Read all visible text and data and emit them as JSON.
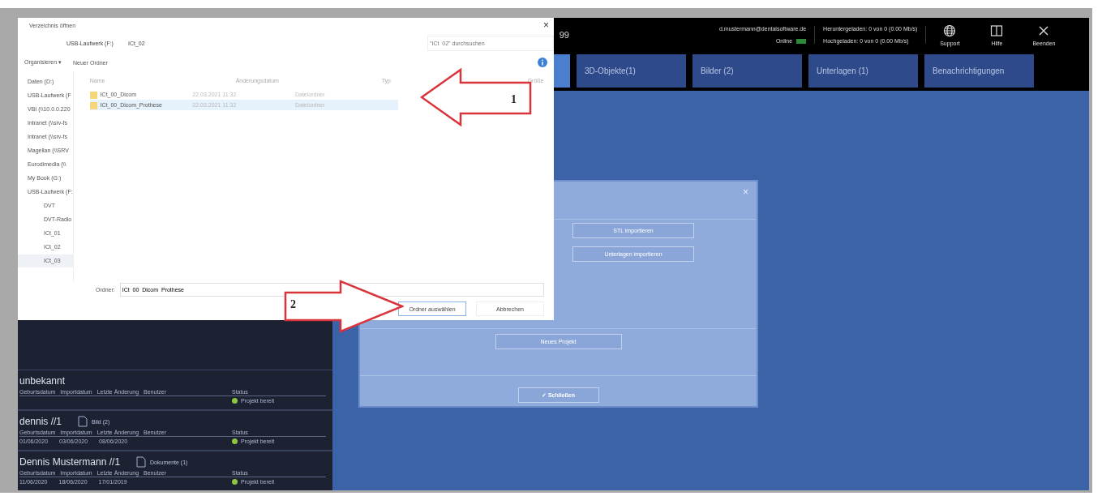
{
  "app": {
    "title_fragment": "99",
    "account": "d.mustermann@dentalsoftware.de",
    "online_label": "Online",
    "online": true,
    "transfers": [
      "Heruntergeladen: 0 von 0 (0.00 Mb/s)",
      "Hochgeladen: 0 von 0 (0.00 Mb/s)"
    ],
    "actions": [
      {
        "kind": "globe",
        "label": "Support"
      },
      {
        "kind": "panel",
        "label": "Hilfe"
      },
      {
        "kind": "close",
        "label": "Beenden"
      }
    ]
  },
  "tabs": [
    {
      "selected": true
    },
    {
      "label": "3D-Objekte(1)",
      "selected": false
    },
    {
      "label": "Bilder (2)",
      "selected": false
    },
    {
      "label": "Unterlagen (1)",
      "selected": false
    },
    {
      "label": "Benachrichtigungen",
      "selected": false
    }
  ],
  "patients": [
    {
      "name": "unbekannt",
      "headers": [
        "Geburtsdatum",
        "Importdatum",
        "Letzte Änderung",
        "Benutzer"
      ],
      "status_label": "Status",
      "status": "Projekt bereit",
      "color": "#8dc63f"
    },
    {
      "name": "dennis //1",
      "attachment": {
        "kind": "file",
        "label": "Bild (2)"
      },
      "headers": [
        "Geburtsdatum",
        "Importdatum",
        "Letzte Änderung",
        "Benutzer"
      ],
      "values": [
        "01/06/2020",
        "03/06/2020",
        "08/06/2020"
      ],
      "status_label": "Status",
      "status": "Projekt bereit",
      "color": "#8dc63f"
    },
    {
      "name": "Dennis Mustermann //1",
      "attachment": {
        "kind": "file",
        "label": "Dokumente (1)"
      },
      "headers": [
        "Geburtsdatum",
        "Importdatum",
        "Letzte Änderung",
        "Benutzer"
      ],
      "values": [
        "11/06/2020",
        "18/06/2020",
        "17/01/2019"
      ],
      "status_label": "Status",
      "status": "Projekt bereit",
      "color": "#8dc63f"
    }
  ],
  "modal": {
    "close": "×",
    "import_buttons": [
      "STL importieren",
      "Unterlagen importieren"
    ],
    "project_button": "Neues Projekt",
    "confirm_button": "✓ Schließen"
  },
  "file_dialog": {
    "title": "Verzeichnis öffnen",
    "close": "×",
    "path": [
      "USB-Laufwerk (F:)",
      "ICt_02"
    ],
    "search_placeholder": "\"ICt_02\" durchsuchen",
    "toolbar": [
      "Organisieren ▾",
      "Neuer Ordner"
    ],
    "nav": [
      {
        "label": "Daten (D:)",
        "kind": "drive",
        "selected": false
      },
      {
        "label": "USB-Laufwerk (F",
        "kind": "drive",
        "selected": false
      },
      {
        "label": "VBI (\\\\10.0.0.220",
        "kind": "network",
        "selected": false
      },
      {
        "label": "Intranet (\\\\srv-fs",
        "kind": "network",
        "selected": false
      },
      {
        "label": "Intranet (\\\\srv-fs",
        "kind": "network",
        "selected": false
      },
      {
        "label": "Magellan (\\\\SRV",
        "kind": "network",
        "selected": false
      },
      {
        "label": "Eurodimedia (\\\\",
        "kind": "network",
        "selected": false
      },
      {
        "label": "My Book (G:)",
        "kind": "drive",
        "selected": false
      },
      {
        "label": "USB-Laufwerk (F:",
        "kind": "drive",
        "selected": false
      },
      {
        "label": "DVT",
        "kind": "folder",
        "selected": false
      },
      {
        "label": "DVT-Radio",
        "kind": "folder",
        "selected": false
      },
      {
        "label": "ICt_01",
        "kind": "folder",
        "selected": false
      },
      {
        "label": "ICt_02",
        "kind": "folder",
        "selected": false
      },
      {
        "label": "ICt_03",
        "kind": "folder",
        "selected": true
      }
    ],
    "columns": [
      "Name",
      "Änderungsdatum",
      "Typ",
      "Größe"
    ],
    "files": [
      {
        "name": "ICt_00_Dicom",
        "date": "22.03.2021 11:32",
        "type": "Dateiordner",
        "selected": false
      },
      {
        "name": "ICt_00_Dicom_Prothese",
        "date": "22.03.2021 11:32",
        "type": "Dateiordner",
        "selected": true
      }
    ],
    "folder_label": "Ordner:",
    "folder_value": "ICt_00_Dicom_Prothese",
    "buttons": [
      "Ordner auswählen",
      "Abbrechen"
    ]
  },
  "callouts": [
    "1",
    "2"
  ]
}
